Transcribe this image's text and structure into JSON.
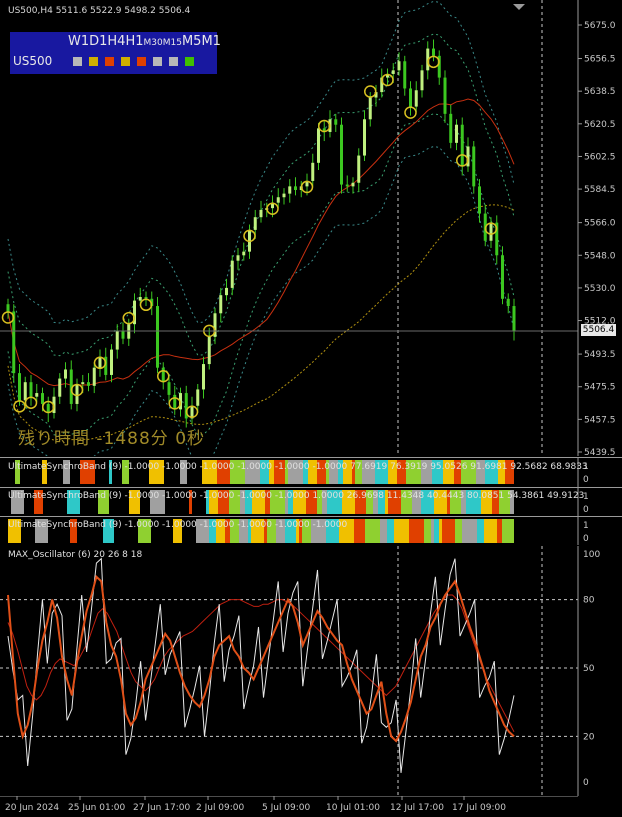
{
  "header": {
    "text": "US500,H4  5511.6 5522.9 5498.2 5506.4"
  },
  "tf_panel": {
    "labels": [
      {
        "t": "W1",
        "small": false
      },
      {
        "t": "D1",
        "small": false
      },
      {
        "t": "H4",
        "small": false
      },
      {
        "t": "H1",
        "small": false
      },
      {
        "t": "M30",
        "small": true
      },
      {
        "t": "M15",
        "small": true
      },
      {
        "t": "M5",
        "small": false
      },
      {
        "t": "M1",
        "small": false
      }
    ],
    "symbol": "US500",
    "squares": [
      "#b8b8b8",
      "#d0b000",
      "#e04000",
      "#d0b000",
      "#e04000",
      "#b8b8b8",
      "#b8b8b8",
      "#40c000"
    ]
  },
  "countdown": "残り時間 -1488分 0秒",
  "current_price": "5506.4",
  "price_axis": [
    "5675.0",
    "5656.5",
    "5638.5",
    "5620.5",
    "5602.5",
    "5584.5",
    "5566.0",
    "5548.0",
    "5530.0",
    "5512.0",
    "5493.5",
    "5475.5",
    "5457.5",
    "5439.5"
  ],
  "time_axis": [
    "20 Jun 2024",
    "25 Jun 01:00",
    "27 Jun 17:00",
    "2 Jul 09:00",
    "5 Jul 09:00",
    "10 Jul 01:00",
    "12 Jul 17:00",
    "17 Jul 09:00"
  ],
  "indicators": {
    "band1": {
      "label": "UltimateSynchroBand (9) -1.0000 -1.0000 -1.0000 -1.0000 -1.0000 -1.0000 77.6919 76.3919 95.0526 91.6981 92.5682 68.9833",
      "axis": [
        "1",
        "0"
      ]
    },
    "band2": {
      "label": "UltimateSynchroBand (9) -1.0000 -1.0000 -1.0000 -1.0000 -1.0000 1.0000 26.9698 11.4348 40.4443 80.0851 54.3861 49.9123",
      "axis": [
        "1",
        "0"
      ]
    },
    "band3": {
      "label": "UltimateSynchroBand (9) -1.0000 -1.0000 -1.0000 -1.0000 -1.0000 -1.0000",
      "axis": [
        "1",
        "0"
      ]
    },
    "osc": {
      "label": "MAX_Oscillator (6) 20 26 8 18",
      "axis": [
        "100",
        "80",
        "50",
        "20",
        "0"
      ]
    }
  },
  "chart_data": [
    {
      "type": "line",
      "title": "US500,H4",
      "ylim": [
        5439.5,
        5675
      ],
      "series": [
        {
          "name": "price close",
          "values": [
            5517,
            5483,
            5468,
            5478,
            5470,
            5472,
            5466,
            5461,
            5470,
            5480,
            5485,
            5466,
            5477,
            5478,
            5476,
            5486,
            5492,
            5482,
            5496,
            5506,
            5502,
            5510,
            5523,
            5525,
            5524,
            5520,
            5486,
            5478,
            5471,
            5463,
            5472,
            5458,
            5465,
            5474,
            5488,
            5503,
            5516,
            5526,
            5530,
            5545,
            5548,
            5550,
            5562,
            5569,
            5573,
            5574,
            5577,
            5580,
            5582,
            5586,
            5584,
            5586,
            5589,
            5599,
            5618,
            5616,
            5623,
            5620,
            5587,
            5586,
            5588,
            5603,
            5623,
            5635,
            5638,
            5646,
            5648,
            5650,
            5655,
            5640,
            5630,
            5639,
            5650,
            5662,
            5658,
            5646,
            5626,
            5610,
            5620,
            5597,
            5608,
            5586,
            5571,
            5556,
            5566,
            5548,
            5524,
            5520,
            5506
          ]
        }
      ]
    },
    {
      "type": "line",
      "title": "MAX_Oscillator (6) 20 26 8 18",
      "ylim": [
        0,
        100
      ],
      "series": [
        {
          "name": "main",
          "values": [
            82,
            55,
            30,
            20,
            25,
            35,
            50,
            62,
            70,
            80,
            72,
            55,
            45,
            38,
            52,
            64,
            75,
            82,
            90,
            88,
            70,
            60,
            55,
            45,
            30,
            25,
            28,
            35,
            45,
            50,
            55,
            60,
            65,
            62,
            55,
            48,
            42,
            38,
            35,
            33,
            38,
            45,
            55,
            60,
            62,
            64,
            58,
            55,
            50,
            48,
            45,
            50,
            55,
            60,
            65,
            70,
            75,
            80,
            77,
            70,
            60,
            65,
            70,
            75,
            72,
            68,
            65,
            62,
            60,
            52,
            45,
            40,
            35,
            30,
            32,
            38,
            44,
            30,
            20,
            18,
            22,
            28,
            35,
            45,
            55,
            60,
            68,
            72,
            78,
            82,
            85,
            88,
            82,
            75,
            68,
            62,
            55,
            48,
            40,
            35,
            30,
            25,
            22,
            20
          ]
        },
        {
          "name": "signal",
          "values": [
            70,
            65,
            58,
            50,
            42,
            38,
            36,
            38,
            42,
            48,
            52,
            54,
            53,
            52,
            51,
            54,
            58,
            62,
            68,
            74,
            76,
            74,
            70,
            66,
            60,
            54,
            48,
            44,
            42,
            40,
            42,
            45,
            50,
            55,
            58,
            60,
            62,
            64,
            65,
            66,
            68,
            70,
            72,
            74,
            76,
            78,
            79,
            80,
            80,
            80,
            79,
            78,
            77,
            77,
            78,
            78,
            79,
            80,
            80,
            79,
            78,
            76,
            74,
            72,
            70,
            68,
            66,
            64,
            62,
            60,
            58,
            56,
            54,
            52,
            50,
            48,
            46,
            44,
            42,
            40,
            38,
            40,
            42,
            46,
            50,
            54,
            58,
            62,
            66,
            70,
            74,
            77,
            80,
            82,
            82,
            80,
            76,
            70,
            64,
            58,
            52,
            46,
            42,
            38,
            34,
            30,
            26,
            22
          ]
        }
      ]
    }
  ]
}
